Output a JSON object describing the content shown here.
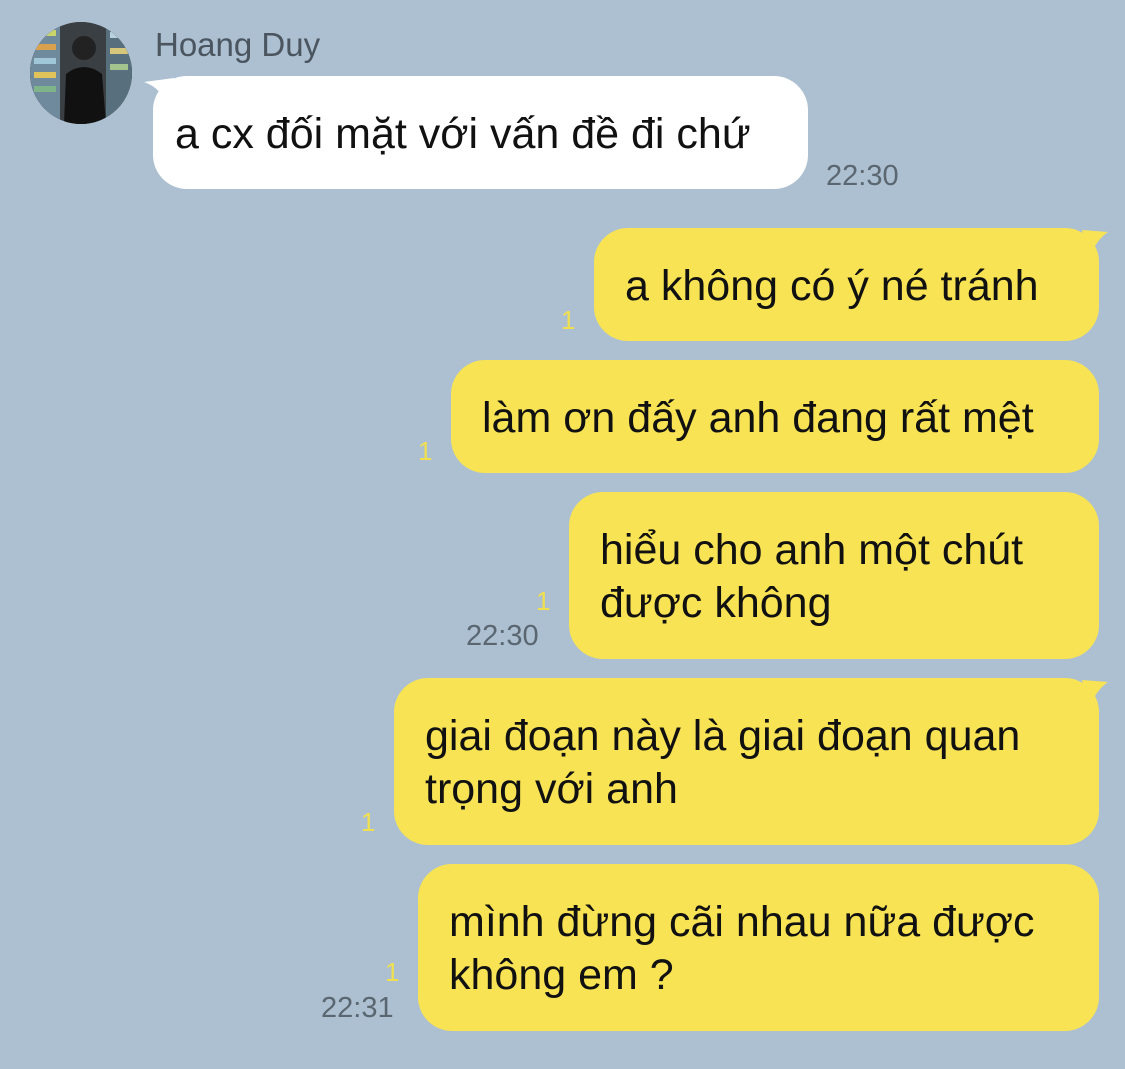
{
  "contact": {
    "name": "Hoang Duy",
    "avatar_icon": "profile-photo"
  },
  "colors": {
    "background": "#adc0d1",
    "incoming_bubble": "#ffffff",
    "outgoing_bubble": "#f7e354",
    "read_count": "#f0e050"
  },
  "messages": [
    {
      "direction": "incoming",
      "text": "a cx đối mặt với vấn đề đi chứ",
      "time": "22:30"
    },
    {
      "direction": "outgoing",
      "text": "a không có ý né tránh",
      "read_count": "1"
    },
    {
      "direction": "outgoing",
      "text": "làm ơn đấy anh đang rất mệt",
      "read_count": "1"
    },
    {
      "direction": "outgoing",
      "line1": "hiểu cho anh một chút",
      "line2": "được không",
      "read_count": "1",
      "time": "22:30"
    },
    {
      "direction": "outgoing",
      "line1": "giai đoạn này là giai đoạn quan",
      "line2": "trọng với anh",
      "read_count": "1"
    },
    {
      "direction": "outgoing",
      "line1": "mình đừng cãi nhau nữa được",
      "line2": "không em ?",
      "read_count": "1",
      "time": "22:31"
    }
  ]
}
